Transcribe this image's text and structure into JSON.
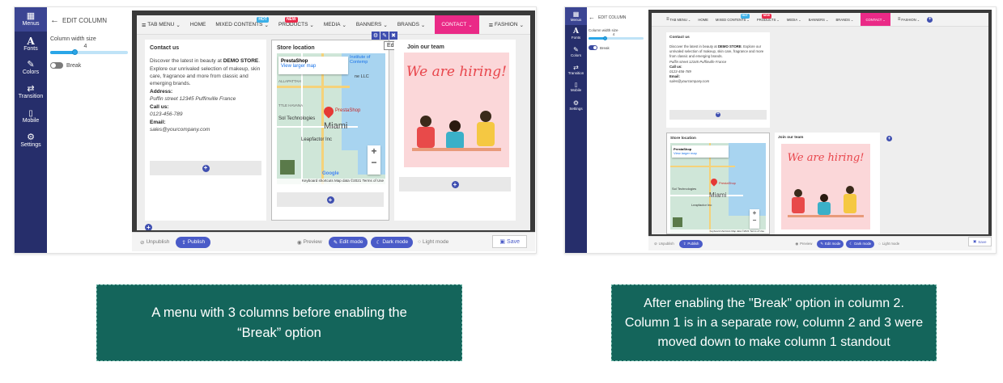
{
  "rail": {
    "items": [
      {
        "icon": "grid-icon",
        "label": "Menus"
      },
      {
        "icon": "font-icon",
        "label": "Fonts"
      },
      {
        "icon": "brush-icon",
        "label": "Colors"
      },
      {
        "icon": "shuffle-icon",
        "label": "Transition"
      },
      {
        "icon": "mobile-icon",
        "label": "Mobile"
      },
      {
        "icon": "gear-icon",
        "label": "Settings"
      }
    ]
  },
  "side": {
    "title": "EDIT COLUMN",
    "width_label": "Column width size",
    "width_value": "4",
    "break_label": "Break"
  },
  "nav": {
    "items": [
      {
        "label": "TAB MENU",
        "caret": true,
        "icon": "menu-icon"
      },
      {
        "label": "HOME"
      },
      {
        "label": "MIXED CONTENTS",
        "caret": true,
        "badge": "HOT"
      },
      {
        "label": "PRODUCTS",
        "caret": true,
        "badge": "NEW"
      },
      {
        "label": "MEDIA",
        "caret": true
      },
      {
        "label": "BANNERS",
        "caret": true
      },
      {
        "label": "BRANDS",
        "caret": true
      },
      {
        "label": "CONTACT",
        "caret": true
      },
      {
        "label": "FASHION",
        "caret": true,
        "icon": "menu-icon"
      }
    ]
  },
  "contact": {
    "title": "Contact us",
    "intro_pre": "Discover the latest in beauty at ",
    "intro_store": "DEMO STORE",
    "intro_post": ". Explore our unrivaled selection of makeup, skin care, fragrance and more from classic and emerging brands.",
    "address_label": "Address:",
    "address": "Puffin street 12345 Puffinville France",
    "call_label": "Call us:",
    "phone": "0123-456-789",
    "email_label": "Email:",
    "email": "sales@yourcompany.com"
  },
  "store": {
    "title": "Store location",
    "shop_name": "PrestaShop",
    "larger_map": "View larger map",
    "city": "Miami",
    "pin_label": "PrestaShop",
    "tech": "Sol Technologies",
    "leapfactor": "Leapfactor Inc",
    "contemp": "Institute of Contemp",
    "llc": "ne LLC",
    "allapattah": "ALLAPATTAH",
    "edgewater": "EDGEWATER",
    "tie": "TTLE HAVANA",
    "brand": "Google",
    "footer": "Keyboard shortcuts   Map data ©2021   Terms of Use"
  },
  "team": {
    "title": "Join our team",
    "hiring": "We are hiring!"
  },
  "toolbar": {
    "edit_tip": "Edit column"
  },
  "bottom": {
    "unpublish": "Unpublish",
    "publish": "Publish",
    "preview": "Preview",
    "edit_mode": "Edit mode",
    "dark_mode": "Dark mode",
    "light_mode": "Light mode",
    "save": "Save"
  },
  "captions": {
    "left": "A menu with 3 columns before enabling the “Break” option",
    "right": "After enabling the \"Break\" option in column 2. Column 1  is in a separate row, column 2 and 3 were moved down to make column 1  standout"
  },
  "colors": {
    "rail": "#262e6b",
    "contact": "#ea2a87",
    "accent": "#3f4fb0",
    "caption": "#14655b"
  }
}
